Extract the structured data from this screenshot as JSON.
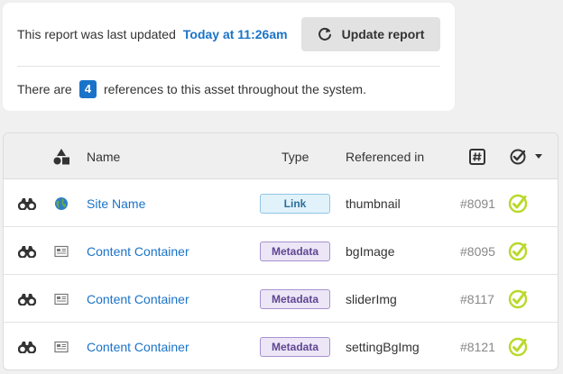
{
  "report": {
    "updated_text": "This report was last updated",
    "updated_time": "Today at 11:26am",
    "update_button_label": "Update report",
    "refs_prefix": "There are",
    "refs_count": "4",
    "refs_suffix": "references to this asset throughout the system."
  },
  "table": {
    "headers": {
      "name": "Name",
      "type": "Type",
      "referenced_in": "Referenced in"
    },
    "rows": [
      {
        "asset_icon": "globe-icon",
        "name": "Site Name",
        "type": "Link",
        "type_kind": "link",
        "referenced_in": "thumbnail",
        "asset_id": "#8091"
      },
      {
        "asset_icon": "container-icon",
        "name": "Content Container",
        "type": "Metadata",
        "type_kind": "metadata",
        "referenced_in": "bgImage",
        "asset_id": "#8095"
      },
      {
        "asset_icon": "container-icon",
        "name": "Content Container",
        "type": "Metadata",
        "type_kind": "metadata",
        "referenced_in": "sliderImg",
        "asset_id": "#8117"
      },
      {
        "asset_icon": "container-icon",
        "name": "Content Container",
        "type": "Metadata",
        "type_kind": "metadata",
        "referenced_in": "settingBgImg",
        "asset_id": "#8121"
      }
    ]
  },
  "colors": {
    "accent": "#1a73c8",
    "status_ok": "#b9d92a"
  }
}
